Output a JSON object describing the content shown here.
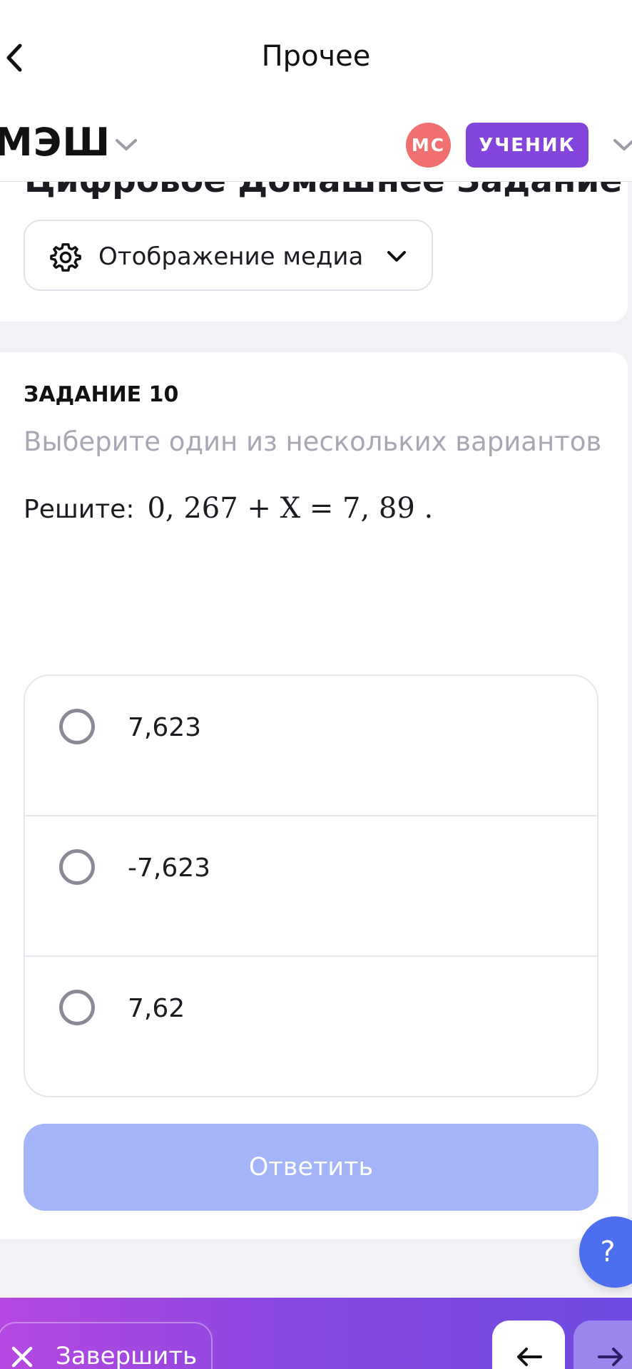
{
  "nav": {
    "title": "Прочее"
  },
  "header": {
    "logo": "МЭШ",
    "avatar_initials": "МС",
    "role": "УЧЕНИК"
  },
  "title_card": {
    "title": "Цифровое Домашнее Задание",
    "media_button": "Отображение медиа"
  },
  "task": {
    "number": "ЗАДАНИЕ 10",
    "instruction": "Выберите один из нескольких вариантов",
    "question_prefix": "Решите:",
    "question_math": "0, 267 + X = 7, 89  .",
    "options": [
      {
        "label": "7,623"
      },
      {
        "label": "-7,623"
      },
      {
        "label": "7,62"
      }
    ],
    "answer_button": "Ответить",
    "help": "?"
  },
  "bottom": {
    "finish": "Завершить"
  },
  "colors": {
    "accent_purple": "#8445dc",
    "avatar_red": "#f07070",
    "answer_disabled": "#a4b4f8",
    "help_blue": "#4c6ff0"
  },
  "icons": [
    "chevron-left-icon",
    "chevron-down-icon",
    "gear-icon",
    "close-icon",
    "arrow-left-icon",
    "arrow-right-icon"
  ]
}
